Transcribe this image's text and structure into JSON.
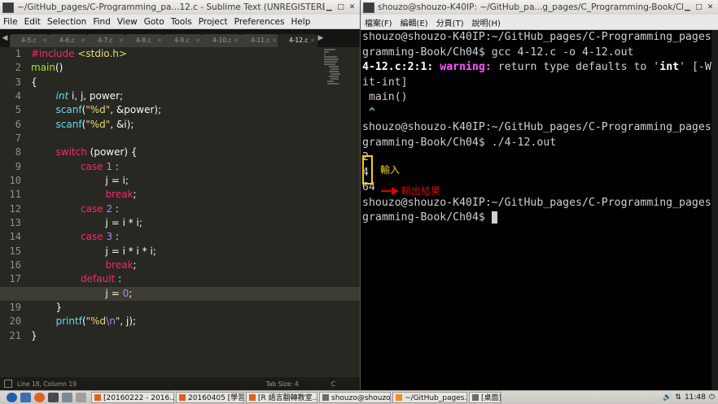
{
  "sublime": {
    "title": "~/GitHub_pages/C-Programming_pa...12.c - Sublime Text (UNREGISTERED)",
    "menu": [
      "File",
      "Edit",
      "Selection",
      "Find",
      "View",
      "Goto",
      "Tools",
      "Project",
      "Preferences",
      "Help"
    ],
    "tabs": [
      "4-5.c",
      "4-6.c",
      "4-7.c",
      "4-8.c",
      "4-9.c",
      "4-10.c",
      "4-11.c",
      "4-12.c"
    ],
    "active_tab_index": 7,
    "line_numbers": [
      "1",
      "2",
      "3",
      "4",
      "5",
      "6",
      "7",
      "8",
      "9",
      "10",
      "11",
      "12",
      "13",
      "14",
      "15",
      "16",
      "17",
      "18",
      "19",
      "20",
      "21"
    ],
    "current_line_index": 17,
    "status": {
      "position": "Line 18, Column 19",
      "tab_size": "Tab Size: 4",
      "syntax": "C"
    }
  },
  "code": {
    "l1a": "#include",
    "l1b": " <stdio.h>",
    "l2": "main",
    "l2b": "()",
    "l3": "{",
    "l4a": "        int",
    "l4b": " i, j, power;",
    "l5a": "        scanf",
    "l5b": "(",
    "l5c": "\"%d\"",
    "l5d": ", &power);",
    "l6a": "        scanf",
    "l6b": "(",
    "l6c": "\"%d\"",
    "l6d": ", &i);",
    "l8a": "        switch",
    "l8b": " (power) {",
    "l9a": "                case",
    "l9b": " 1",
    "l9c": " :",
    "l10": "                        j = i;",
    "l11": "                        break",
    "l11b": ";",
    "l12a": "                case",
    "l12b": " 2",
    "l12c": " :",
    "l13": "                        j = i * i;",
    "l14a": "                case",
    "l14b": " 3",
    "l14c": " :",
    "l15": "                        j = i * i * i;",
    "l16": "                        break",
    "l16b": ";",
    "l17a": "                default",
    "l17b": " :",
    "l18a": "                        j = ",
    "l18b": "0",
    "l18c": ";",
    "l19": "        }",
    "l20a": "        printf",
    "l20b": "(",
    "l20c": "\"%d",
    "l20d": "\\n",
    "l20e": "\"",
    "l20f": ", j);",
    "l21": "}"
  },
  "terminal": {
    "title": "shouzo@shouzo-K40IP: ~/GitHub_pa...g_pages/C_Programming-Book/Ch04",
    "menu": [
      "檔案(F)",
      "編輯(E)",
      "分頁(T)",
      "說明(H)"
    ],
    "lines": {
      "p1a": "shouzo@shouzo-K40IP:~/GitHub_pages/C-Programming_pages/C_Pro",
      "p1b": "gramming-Book/Ch04$ gcc 4-12.c -o 4-12.out",
      "w_loc": "4-12.c:2:1:",
      "w_tag": " warning:",
      "w_msg": " return type defaults to '",
      "w_int": "int",
      "w_end": "' [-Wimplic",
      "w2": "it-int]",
      "src": " main()",
      "caret": " ^",
      "p2a": "shouzo@shouzo-K40IP:~/GitHub_pages/C-Programming_pages/C_Pro",
      "p2b": "gramming-Book/Ch04$ ./4-12.out",
      "in1": "2",
      "in2": "4",
      "out": "64",
      "p3a": "shouzo@shouzo-K40IP:~/GitHub_pages/C-Programming_pages/C_Pro",
      "p3b": "gramming-Book/Ch04$ "
    },
    "annotation_input": "輸入",
    "annotation_output": "輸出結果",
    "annotation_color_input": "#f5d000",
    "annotation_color_output": "#e00000"
  },
  "taskbar": {
    "tasks": [
      "[20160222 - 2016...",
      "20160405 [學習...",
      "[R 語言翻轉教室...",
      "shouzo@shouzo...",
      "~/GitHub_pages...",
      "[桌面]"
    ],
    "clock": "11:48"
  }
}
